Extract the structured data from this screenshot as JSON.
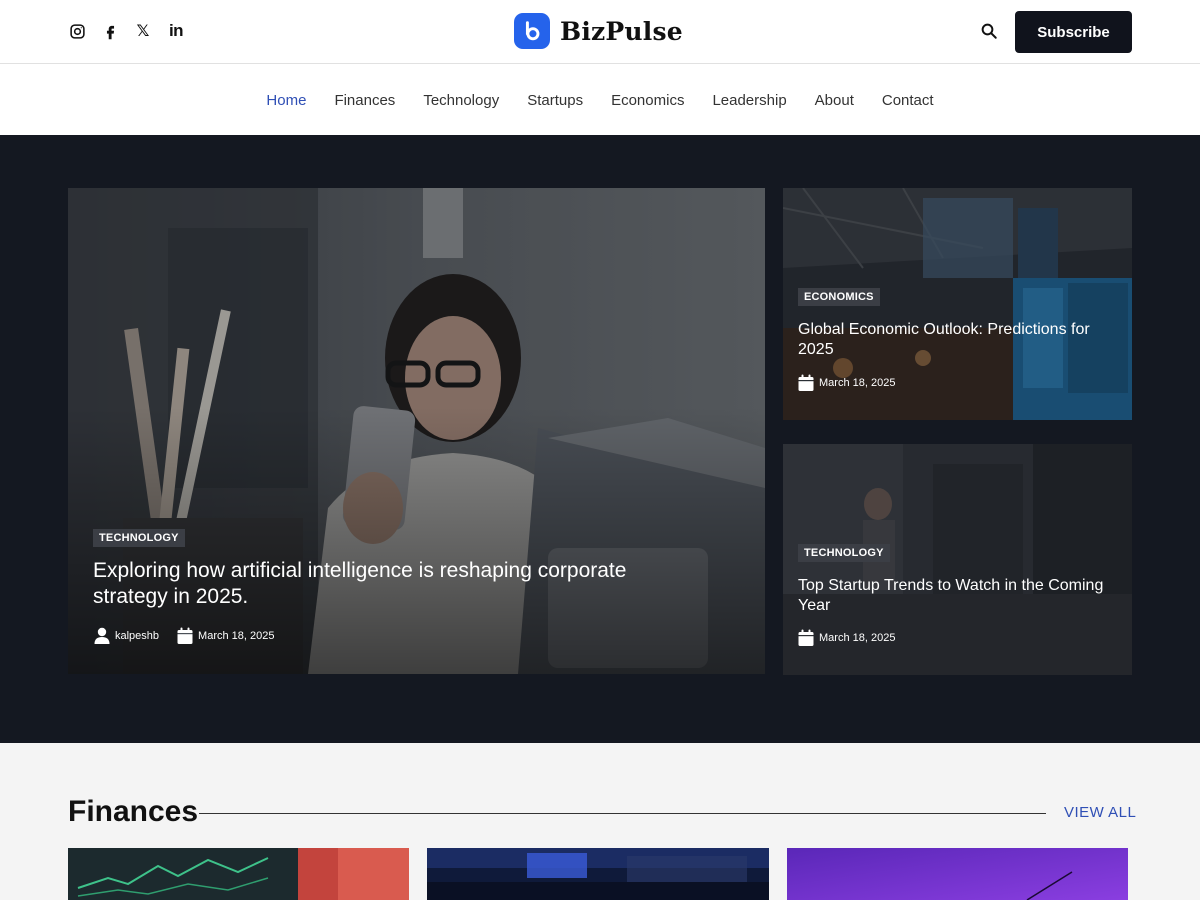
{
  "header": {
    "social_icons": [
      "instagram-icon",
      "facebook-icon",
      "x-icon",
      "linkedin-icon"
    ],
    "x_glyph": "𝕏",
    "linkedin_glyph": "in",
    "brand_name": "BizPulse",
    "subscribe_label": "Subscribe"
  },
  "nav": {
    "items": [
      "Home",
      "Finances",
      "Technology",
      "Startups",
      "Economics",
      "Leadership",
      "About",
      "Contact"
    ],
    "active": "Home"
  },
  "featured": {
    "main": {
      "category": "TECHNOLOGY",
      "title": "Exploring how artificial intelligence is reshaping corporate strategy in 2025.",
      "author": "kalpeshb",
      "date": "March 18, 2025"
    },
    "side": [
      {
        "category": "ECONOMICS",
        "title": "Global Economic Outlook: Predictions for 2025",
        "date": "March 18, 2025"
      },
      {
        "category": "TECHNOLOGY",
        "title": "Top Startup Trends to Watch in the Coming Year",
        "date": "March 18, 2025"
      }
    ]
  },
  "finances": {
    "title": "Finances",
    "view_all": "VIEW ALL"
  },
  "colors": {
    "accent": "#2563eb",
    "nav_active": "#2f4fb5",
    "hero_bg": "#141821",
    "button_bg": "#10131c",
    "section_bg": "#f4f4f4"
  }
}
